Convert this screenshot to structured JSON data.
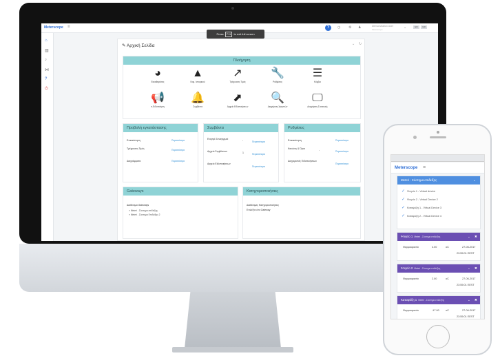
{
  "desktop": {
    "brand": "Meterscope",
    "fullscreen_prefix": "Press",
    "fullscreen_key": "F11",
    "fullscreen_suffix": "to exit full screen",
    "user_name": "Demonstration User",
    "user_sub": "Meterscope",
    "lang_a": "EN",
    "lang_b": "GR",
    "page_title": "Αρχική Σελίδα",
    "navigation": {
      "title": "Πλοήγηση",
      "items": [
        {
          "label": "Εκκαθαρίσεις",
          "glyph": "◕"
        },
        {
          "label": "Καμ. Ιστορικού",
          "glyph": "▲"
        },
        {
          "label": "Τρέχουσες Τιμές",
          "glyph": "↗"
        },
        {
          "label": "Ρυθμίσεις",
          "glyph": "🔧"
        },
        {
          "label": "Κόμβοι",
          "glyph": "☰"
        },
        {
          "label": "e-Ειδοποίηση",
          "glyph": "📢"
        },
        {
          "label": "Συμβάντα",
          "glyph": "🔔"
        },
        {
          "label": "Αρχείο Ειδοποιήσεων",
          "glyph": "⬈"
        },
        {
          "label": "Διαχείριση Χρηστών",
          "glyph": "🔍"
        },
        {
          "label": "Διαχείριση Συσκευής",
          "glyph": "🖵"
        }
      ]
    },
    "install_view": {
      "title": "Προβολή εγκατάστασης",
      "rows": [
        {
          "label": "Επισκόπηση",
          "link": "Περισσότερα"
        },
        {
          "label": "Τρέχουσες Τιμές",
          "link": "Περισσότερα"
        },
        {
          "label": "Διαγράμματα",
          "link": "Περισσότερα"
        }
      ]
    },
    "events": {
      "title": "Συμβάντα",
      "rows": [
        {
          "label": "Ενεργά Συναγερμοί",
          "count": "-",
          "link": "Περισσότερα"
        },
        {
          "label": "Αρχείο Συμβάντων",
          "count": "1",
          "link": "Περισσότερα"
        },
        {
          "label": "Αρχείο Ειδοποιήσεων",
          "count": "",
          "link": "Περισσότερα"
        }
      ]
    },
    "settings": {
      "title": "Ρυθμίσεις",
      "rows": [
        {
          "label": "Επισκόπηση",
          "count": "",
          "link": "Περισσότερα"
        },
        {
          "label": "Κανόνες & Όρια",
          "count": "-",
          "link": "Περισσότερα"
        },
        {
          "label": "Διαχειριστές Ειδοποιήσεων",
          "count": "",
          "link": "Περισσότερα"
        }
      ]
    },
    "gateways": {
      "title": "Gateways",
      "subtitle": "Διαθέσιμα Gateways",
      "items": [
        "Meteri - Σύστημα επιδείξης",
        "Meteri - Σύστημα Επιδείξης 2"
      ]
    },
    "categories": {
      "title": "Κατηγοριοποιήσεις",
      "line1": "Διαθέσιμες Κατηγοριοποιήσεις",
      "line2": "Επιλέξτε ένα Gateway"
    }
  },
  "phone": {
    "brand": "Meterscope",
    "device_panel": {
      "title": "Meteri - Σύστημα επιδείξης",
      "devices": [
        "Ψυγείο 1 - Virtual device",
        "Ψυγείο 2 - Virtual Device 2",
        "Καταψύξη 1 - Virtual Device 3",
        "Καταψύξη 2 - Virtual Device 4"
      ]
    },
    "readings": [
      {
        "name": "Ψυγείο 1",
        "sub": "Meteri - Σύστημα επιδείξης",
        "label": "Θερμοκρασία",
        "value": "4.00",
        "unit": "oC",
        "date": "27-06-2017",
        "time": "23:55:01 EEST"
      },
      {
        "name": "Ψυγείο 2",
        "sub": "Meteri - Σύστημα επιδείξης",
        "label": "Θερμοκρασία",
        "value": "2.00",
        "unit": "oC",
        "date": "27-06-2017",
        "time": "23:55:01 EEST"
      },
      {
        "name": "Καταψύξη 1",
        "sub": "Meteri - Σύστημα επιδείξης",
        "label": "Θερμοκρασία",
        "value": "-17.00",
        "unit": "oC",
        "date": "27-06-2017",
        "time": "23:55:01 EEST"
      }
    ]
  }
}
